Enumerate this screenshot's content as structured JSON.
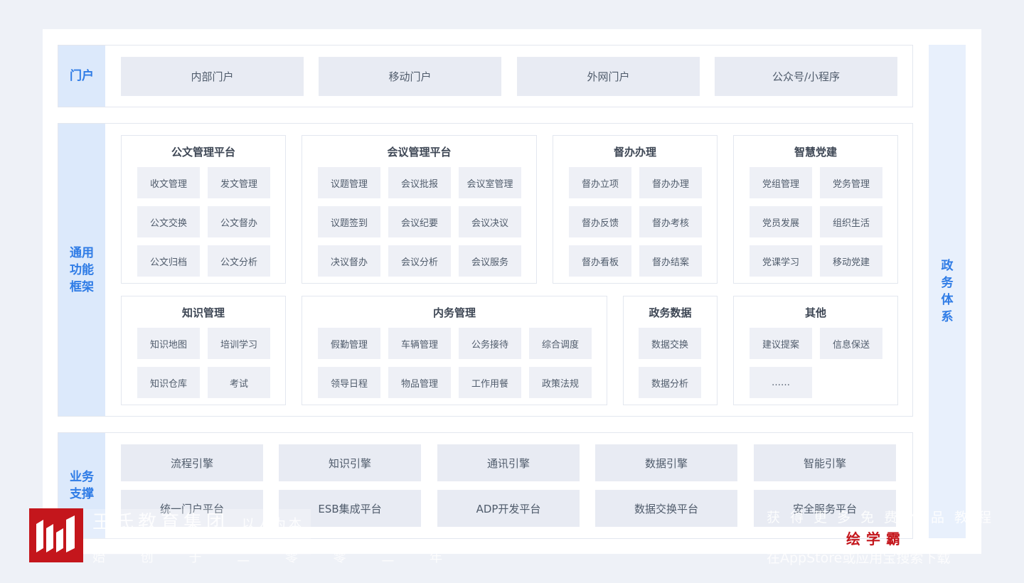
{
  "portal": {
    "label": "门户",
    "items": [
      "内部门户",
      "移动门户",
      "外网门户",
      "公众号/小程序"
    ]
  },
  "general": {
    "label_lines": [
      "通用",
      "功能",
      "框架"
    ],
    "groups": [
      {
        "title": "公文管理平台",
        "items": [
          "收文管理",
          "发文管理",
          "公文交换",
          "公文督办",
          "公文归档",
          "公文分析"
        ]
      },
      {
        "title": "会议管理平台",
        "items": [
          "议题管理",
          "会议批报",
          "会议室管理",
          "议题签到",
          "会议纪要",
          "会议决议",
          "决议督办",
          "会议分析",
          "会议服务"
        ]
      },
      {
        "title": "督办办理",
        "items": [
          "督办立项",
          "督办办理",
          "督办反馈",
          "督办考核",
          "督办看板",
          "督办结案"
        ]
      },
      {
        "title": "智慧党建",
        "items": [
          "党组管理",
          "党务管理",
          "党员发展",
          "组织生活",
          "党课学习",
          "移动党建"
        ]
      },
      {
        "title": "知识管理",
        "items": [
          "知识地图",
          "培训学习",
          "知识仓库",
          "考试"
        ]
      },
      {
        "title": "内务管理",
        "items": [
          "假勤管理",
          "车辆管理",
          "公务接待",
          "综合调度",
          "领导日程",
          "物品管理",
          "工作用餐",
          "政策法规"
        ]
      },
      {
        "title": "政务数据",
        "items": [
          "数据交换",
          "数据分析"
        ]
      },
      {
        "title": "其他",
        "items": [
          "建议提案",
          "信息保送",
          "……"
        ]
      }
    ]
  },
  "support": {
    "label_lines": [
      "业务",
      "支撑"
    ],
    "row1": [
      "流程引擎",
      "知识引擎",
      "通讯引擎",
      "数据引擎",
      "智能引擎"
    ],
    "row2": [
      "统一门户平台",
      "ESB集成平台",
      "ADP开发平台",
      "数据交换平台",
      "安全服务平台"
    ]
  },
  "right": {
    "chars": [
      "政",
      "务",
      "体",
      "系"
    ]
  },
  "watermark": {
    "brand": "王氏教育集团",
    "slogan": "以人为本",
    "line2": "始 创 于 二 零 零 二 年",
    "promo": "获得更多免费作品教程",
    "app": "绘学霸",
    "download": "在AppStore或应用宝搜索下载"
  },
  "colors": {
    "accent": "#2f7ce6",
    "label_bg": "#dce9fb",
    "box_bg": "#e8ebf3",
    "brand_red": "#c4161c"
  }
}
